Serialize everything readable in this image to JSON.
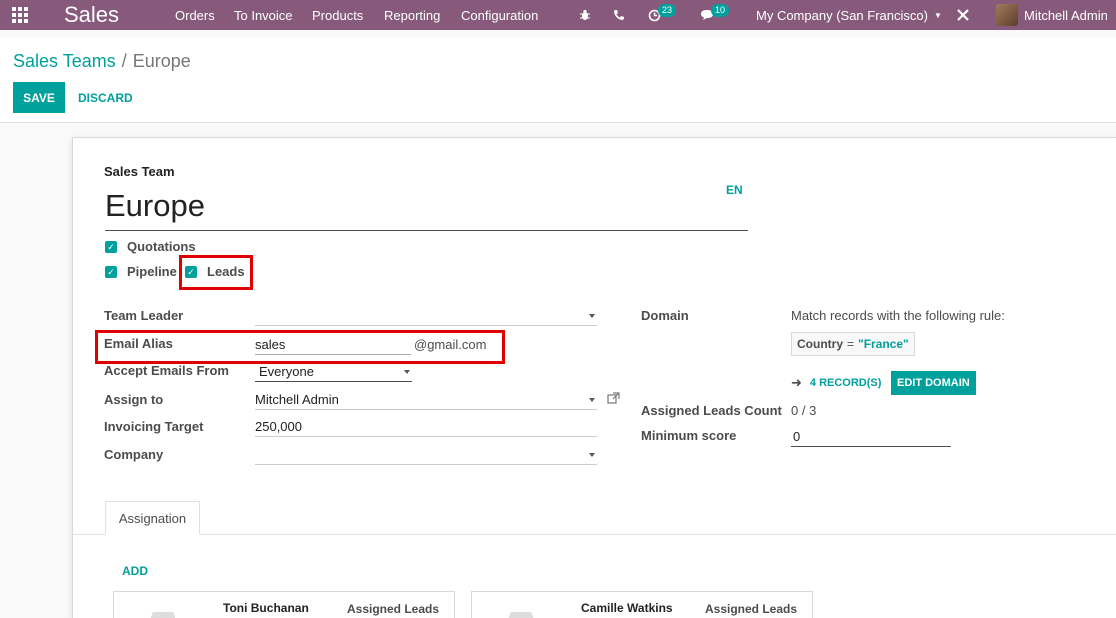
{
  "navbar": {
    "app_name": "Sales",
    "menu": [
      "Orders",
      "To Invoice",
      "Products",
      "Reporting",
      "Configuration"
    ],
    "activity_badge": "23",
    "messages_badge": "10",
    "company": "My Company (San Francisco)",
    "user": "Mitchell Admin",
    "color": "#875a7b"
  },
  "breadcrumb": {
    "parent": "Sales Teams",
    "separator": "/",
    "current": "Europe"
  },
  "actions": {
    "save": "SAVE",
    "discard": "DISCARD"
  },
  "form": {
    "caption": "Sales Team",
    "name": "Europe",
    "lang": "EN",
    "checkboxes": {
      "quotations": "Quotations",
      "pipeline": "Pipeline",
      "leads": "Leads"
    },
    "fields": {
      "team_leader_label": "Team Leader",
      "team_leader_value": "",
      "email_alias_label": "Email Alias",
      "email_alias_value": "sales",
      "email_alias_domain": "@gmail.com",
      "accept_emails_label": "Accept Emails From",
      "accept_emails_value": "Everyone",
      "assign_to_label": "Assign to",
      "assign_to_value": "Mitchell Admin",
      "invoicing_target_label": "Invoicing Target",
      "invoicing_target_value": "250,000",
      "company_label": "Company",
      "company_value": ""
    },
    "domain": {
      "label": "Domain",
      "rule_text": "Match records with the following rule:",
      "chip_key": "Country",
      "chip_op": "=",
      "chip_value": "\"France\"",
      "records_link": "4 RECORD(S)",
      "edit_button": "EDIT DOMAIN"
    },
    "assigned_leads_label": "Assigned Leads Count",
    "assigned_leads_value": "0 / 3",
    "min_score_label": "Minimum score",
    "min_score_value": "0"
  },
  "tabs": {
    "active": "Assignation"
  },
  "assignation": {
    "add": "ADD",
    "members": [
      {
        "name": "Toni Buchanan",
        "assigned_label": "Assigned Leads"
      },
      {
        "name": "Camille Watkins",
        "assigned_label": "Assigned Leads"
      }
    ]
  }
}
